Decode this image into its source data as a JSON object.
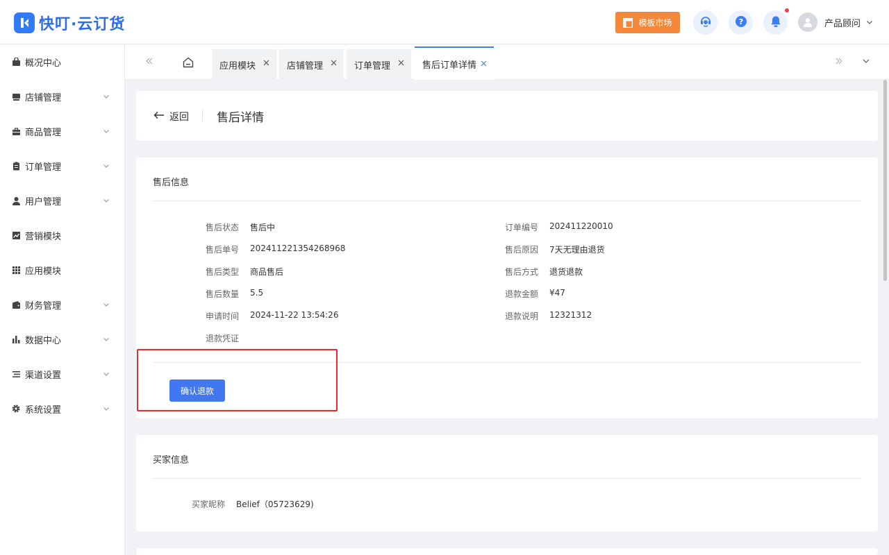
{
  "app": {
    "logo_text": "快叮·云订货"
  },
  "header": {
    "template_market": "模板市场",
    "user_name": "产品顾问",
    "icons": [
      "customer-service-icon",
      "help-icon",
      "bell-icon",
      "user-avatar-icon"
    ]
  },
  "sidebar": {
    "items": [
      {
        "label": "概况中心",
        "icon": "dashboard-icon",
        "expandable": false
      },
      {
        "label": "店铺管理",
        "icon": "store-icon",
        "expandable": true
      },
      {
        "label": "商品管理",
        "icon": "briefcase-icon",
        "expandable": true
      },
      {
        "label": "订单管理",
        "icon": "clipboard-icon",
        "expandable": true
      },
      {
        "label": "用户管理",
        "icon": "user-icon",
        "expandable": true
      },
      {
        "label": "营销模块",
        "icon": "trend-chart-icon",
        "expandable": false
      },
      {
        "label": "应用模块",
        "icon": "grid-icon",
        "expandable": false
      },
      {
        "label": "财务管理",
        "icon": "wallet-icon",
        "expandable": true
      },
      {
        "label": "数据中心",
        "icon": "bar-chart-icon",
        "expandable": true
      },
      {
        "label": "渠道设置",
        "icon": "list-icon",
        "expandable": true
      },
      {
        "label": "系统设置",
        "icon": "gear-icon",
        "expandable": true
      }
    ]
  },
  "tabs": [
    {
      "label": "应用模块",
      "active": false
    },
    {
      "label": "店铺管理",
      "active": false
    },
    {
      "label": "订单管理",
      "active": false
    },
    {
      "label": "售后订单详情",
      "active": true
    }
  ],
  "page": {
    "back_label": "返回",
    "title": "售后详情"
  },
  "after_sale": {
    "section_title": "售后信息",
    "left": [
      {
        "label": "售后状态",
        "value": "售后中"
      },
      {
        "label": "售后单号",
        "value": "202411221354268968"
      },
      {
        "label": "售后类型",
        "value": "商品售后"
      },
      {
        "label": "售后数量",
        "value": "5.5"
      },
      {
        "label": "申请时间",
        "value": "2024-11-22 13:54:26"
      },
      {
        "label": "退款凭证",
        "value": ""
      }
    ],
    "right": [
      {
        "label": "订单编号",
        "value": "202411220010"
      },
      {
        "label": "售后原因",
        "value": "7天无理由退货"
      },
      {
        "label": "售后方式",
        "value": "退货退款"
      },
      {
        "label": "退款金额",
        "value": "¥47"
      },
      {
        "label": "退款说明",
        "value": "12321312"
      }
    ],
    "confirm_button": "确认退款"
  },
  "buyer": {
    "section_title": "买家信息",
    "nickname_label": "买家昵称",
    "nickname_value": "Belief（05723629)"
  },
  "colors": {
    "primary": "#4178f2",
    "accent_orange": "#f5873a",
    "highlight_red": "#e42a2a"
  }
}
